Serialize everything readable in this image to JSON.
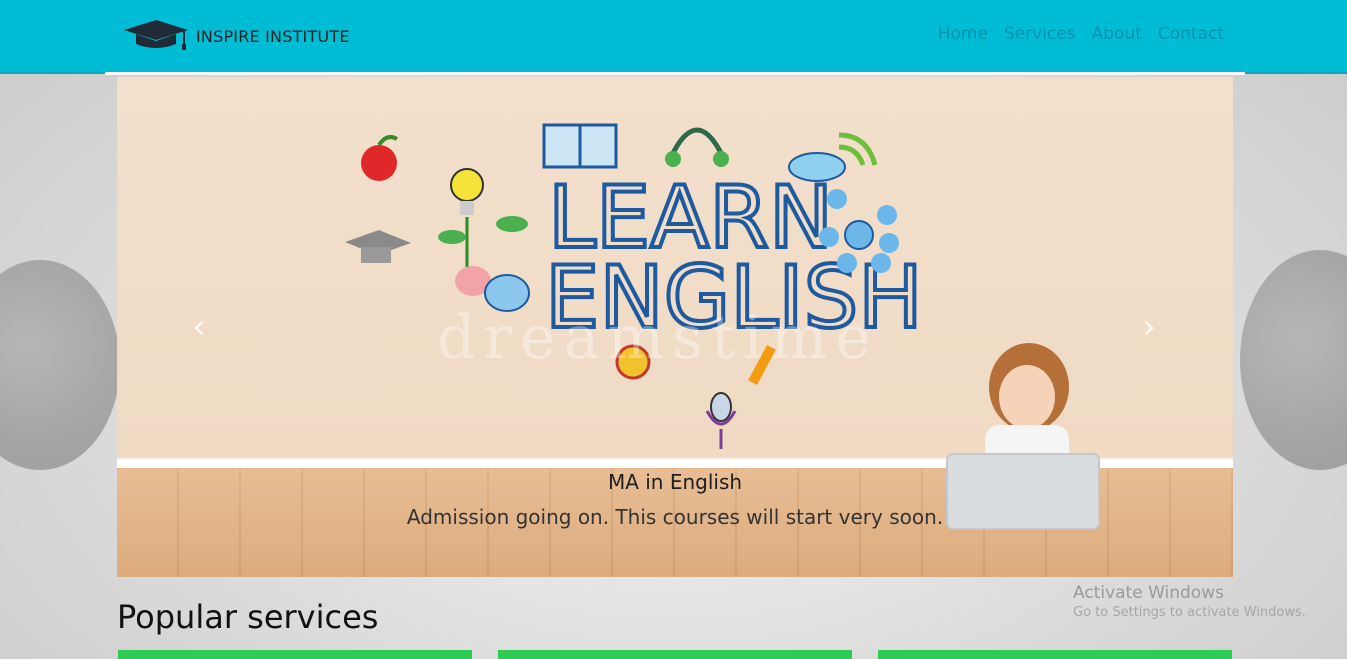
{
  "navbar": {
    "brand": "INSPIRE INSTITUTE",
    "links": [
      "Home",
      "Services",
      "About",
      "Contact"
    ]
  },
  "carousel": {
    "image_text_line1": "LEARN",
    "image_text_line2": "ENGLISH",
    "watermark": "dreamstime",
    "caption_title": "MA in English",
    "caption_text": "Admission going on. This courses will start very soon.",
    "prev_icon": "chevron-left-icon",
    "next_icon": "chevron-right-icon"
  },
  "popular": {
    "title": "Popular services",
    "card_color": "#2ecc55"
  },
  "os_overlay": {
    "title": "Activate Windows",
    "subtitle": "Go to Settings to activate Windows."
  },
  "colors": {
    "navbar_bg": "#00bcd4",
    "nav_link": "#0092a8"
  }
}
